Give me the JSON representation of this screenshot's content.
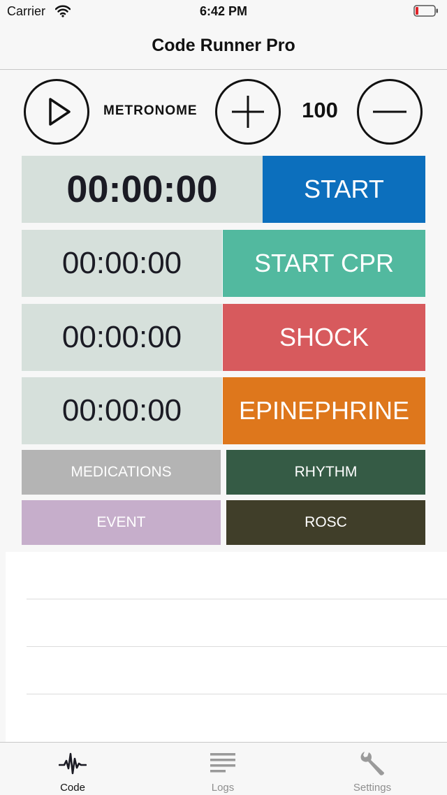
{
  "status_bar": {
    "carrier": "Carrier",
    "time": "6:42 PM"
  },
  "nav": {
    "title": "Code Runner Pro"
  },
  "metronome": {
    "label": "METRONOME",
    "bpm": "100",
    "play_icon": "play-icon",
    "plus_icon": "plus-icon",
    "minus_icon": "minus-icon"
  },
  "timers": {
    "main": "00:00:00",
    "cpr": "00:00:00",
    "shock": "00:00:00",
    "epinephrine": "00:00:00"
  },
  "actions": {
    "start": {
      "label": "START",
      "color": "#0c6fbd"
    },
    "start_cpr": {
      "label": "START CPR",
      "color": "#52b99f"
    },
    "shock": {
      "label": "SHOCK",
      "color": "#d75a5d"
    },
    "epinephrine": {
      "label": "EPINEPHRINE",
      "color": "#de771c"
    }
  },
  "quick_buttons": {
    "medications": {
      "label": "MEDICATIONS",
      "color": "#b4b4b4"
    },
    "rhythm": {
      "label": "RHYTHM",
      "color": "#355b45"
    },
    "event": {
      "label": "EVENT",
      "color": "#c6aecb"
    },
    "rosc": {
      "label": "ROSC",
      "color": "#403e29"
    }
  },
  "timer_background": "#d6e0db",
  "tab_bar": {
    "tabs": [
      {
        "label": "Code",
        "icon": "heartbeat-icon",
        "selected": true
      },
      {
        "label": "Logs",
        "icon": "list-icon",
        "selected": false
      },
      {
        "label": "Settings",
        "icon": "wrench-icon",
        "selected": false
      }
    ]
  }
}
